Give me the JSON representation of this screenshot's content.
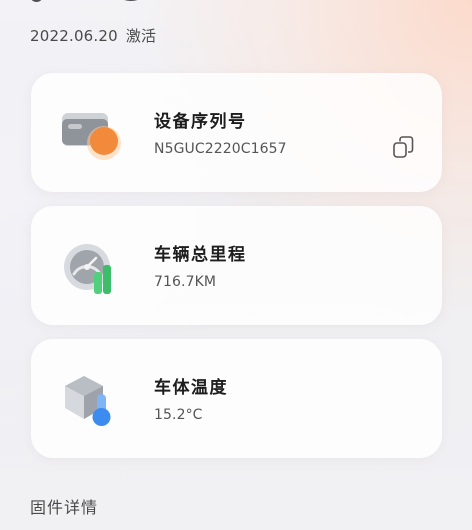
{
  "activation": {
    "date": "2022.06.20",
    "status": "激活"
  },
  "cards": [
    {
      "id": "serial",
      "icon": "device-card-icon",
      "title": "设备序列号",
      "value": "N5GUC2220C1657",
      "action_icon": "copy-icon"
    },
    {
      "id": "mileage",
      "icon": "speedometer-icon",
      "title": "车辆总里程",
      "value": "716.7KM"
    },
    {
      "id": "temperature",
      "icon": "thermometer-cube-icon",
      "title": "车体温度",
      "value": "15.2°C"
    }
  ],
  "section": {
    "firmware_label": "固件详情"
  },
  "colors": {
    "accent_orange": "#f28a3b",
    "accent_green": "#4fd07b",
    "accent_blue": "#3c8cf0",
    "card_bg": "#ffffff",
    "page_bg": "#f1f1f4"
  }
}
